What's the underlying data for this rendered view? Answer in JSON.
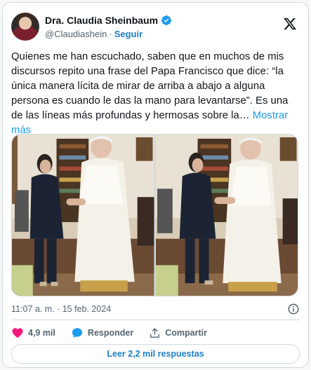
{
  "author": {
    "name": "Dra. Claudia Sheinbaum",
    "handle": "@Claudiashein",
    "separator": "·",
    "follow_label": "Seguir"
  },
  "tweet": {
    "text": "Quienes me han escuchado, saben que en muchos de mis discursos repito una frase del Papa Francisco que dice: “la única manera lícita de mirar de arriba a abajo a alguna persona es cuando le das la mano para levantarse”. Es una de las líneas más profundas y hermosas sobre la…",
    "more_label": "Mostrar más"
  },
  "photos": [
    {
      "icon": "photo-meeting-1"
    },
    {
      "icon": "photo-meeting-2"
    }
  ],
  "meta": {
    "timestamp": "11:07 a. m. · 15 feb. 2024"
  },
  "actions": {
    "likes": "4,9 mil",
    "reply_label": "Responder",
    "share_label": "Compartir"
  },
  "read_replies_label": "Leer 2,2 mil respuestas",
  "colors": {
    "accent": "#1d9bf0",
    "like": "#f91880",
    "text": "#0f1419",
    "muted": "#536471"
  }
}
